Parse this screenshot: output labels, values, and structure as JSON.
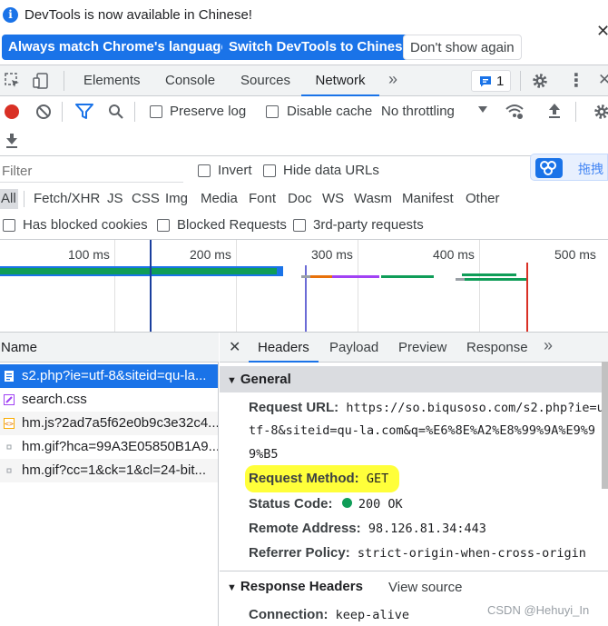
{
  "infobar": {
    "message": "DevTools is now available in Chinese!",
    "btn_match": "Always match Chrome's language",
    "btn_switch": "Switch DevTools to Chinese",
    "btn_dont": "Don't show again"
  },
  "tabs": {
    "elements": "Elements",
    "console": "Console",
    "sources": "Sources",
    "network": "Network",
    "badge": "1"
  },
  "toolbar": {
    "preserve_log": "Preserve log",
    "disable_cache": "Disable cache",
    "throttling": "No throttling"
  },
  "filter": {
    "placeholder": "Filter",
    "invert": "Invert",
    "hide_data_urls": "Hide data URLs",
    "types": [
      "All",
      "Fetch/XHR",
      "JS",
      "CSS",
      "Img",
      "Media",
      "Font",
      "Doc",
      "WS",
      "Wasm",
      "Manifest",
      "Other"
    ],
    "blocked_cookies": "Has blocked cookies",
    "blocked_requests": "Blocked Requests",
    "third_party": "3rd-party requests",
    "overlay_text": "拖拽"
  },
  "timeline": {
    "ticks": [
      "100 ms",
      "200 ms",
      "300 ms",
      "400 ms",
      "500 ms"
    ]
  },
  "requests": {
    "header": "Name",
    "items": [
      "s2.php?ie=utf-8&siteid=qu-la...",
      "search.css",
      "hm.js?2ad7a5f62e0b9c3e32c4...",
      "hm.gif?hca=99A3E05850B1A9...",
      "hm.gif?cc=1&ck=1&cl=24-bit..."
    ]
  },
  "details": {
    "tabs": [
      "Headers",
      "Payload",
      "Preview",
      "Response"
    ],
    "general_title": "General",
    "request_url_label": "Request URL:",
    "request_url_line1": "https://so.biqusoso.com/s2.php?ie=u",
    "request_url_line2": "tf-8&siteid=qu-la.com&q=%E6%8E%A2%E8%99%9A%E9%9",
    "request_url_line3": "9%B5",
    "request_method_label": "Request Method:",
    "request_method_value": "GET",
    "status_code_label": "Status Code:",
    "status_code_value": "200 OK",
    "remote_address_label": "Remote Address:",
    "remote_address_value": "98.126.81.34:443",
    "referrer_policy_label": "Referrer Policy:",
    "referrer_policy_value": "strict-origin-when-cross-origin",
    "response_headers_title": "Response Headers",
    "view_source": "View source",
    "connection_label": "Connection:",
    "connection_value": "keep-alive"
  },
  "watermark": "CSDN @Hehuyi_In",
  "colors": {
    "accent": "#1a73e8",
    "highlight": "#ffff3a",
    "status_ok": "#0f9d58"
  }
}
